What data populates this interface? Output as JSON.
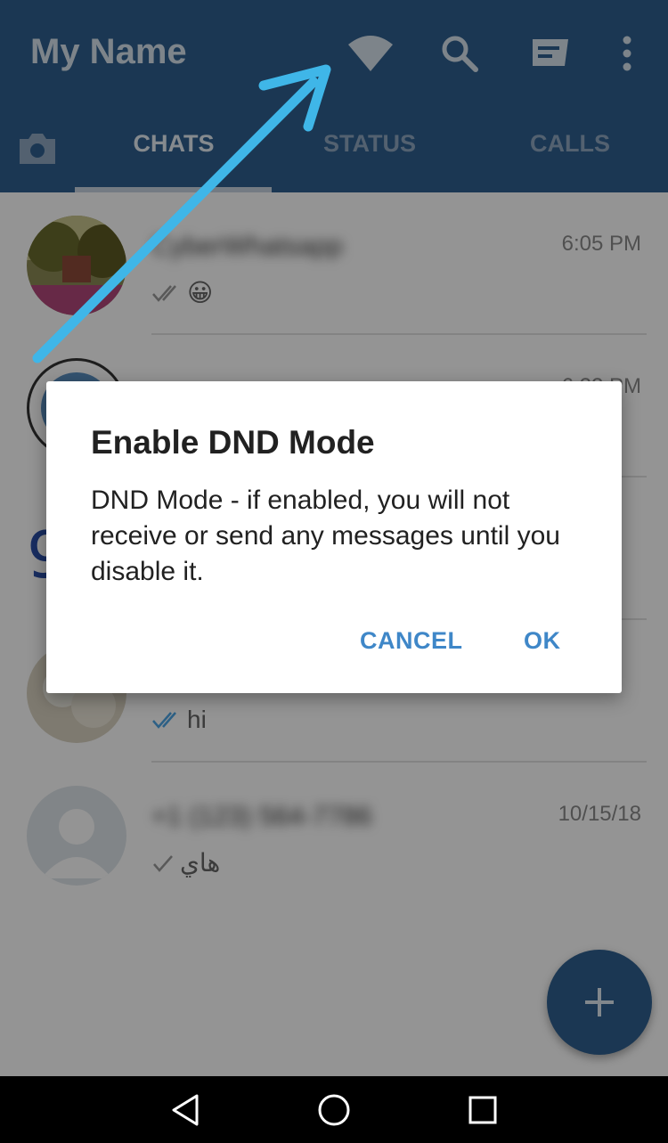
{
  "header": {
    "title": "My Name",
    "icons": [
      "wifi-icon",
      "search-icon",
      "new-chat-icon",
      "more-vert-icon"
    ],
    "tabs": [
      {
        "label": "CHATS",
        "active": true
      },
      {
        "label": "STATUS",
        "active": false
      },
      {
        "label": "CALLS",
        "active": false
      }
    ]
  },
  "chats": [
    {
      "name": "CyberWhatsapp",
      "time": "6:05 PM",
      "message": "😀",
      "status": "read"
    },
    {
      "name": "",
      "time": "6:22 PM",
      "message": "",
      "status": ""
    },
    {
      "name": "",
      "time": "",
      "message": "",
      "status": ""
    },
    {
      "name": "",
      "time": "",
      "message": "hi",
      "status": "read"
    },
    {
      "name": "+1 (123) 564-7786",
      "time": "10/15/18",
      "message": "هاي",
      "status": "sent"
    }
  ],
  "dialog": {
    "title": "Enable DND Mode",
    "body": "DND Mode - if enabled, you will not receive or send any messages until you disable it.",
    "cancel_label": "CANCEL",
    "ok_label": "OK"
  },
  "colors": {
    "primary": "#30608f",
    "accent": "#3f87c8",
    "annotation_arrow": "#3fb6e8"
  }
}
